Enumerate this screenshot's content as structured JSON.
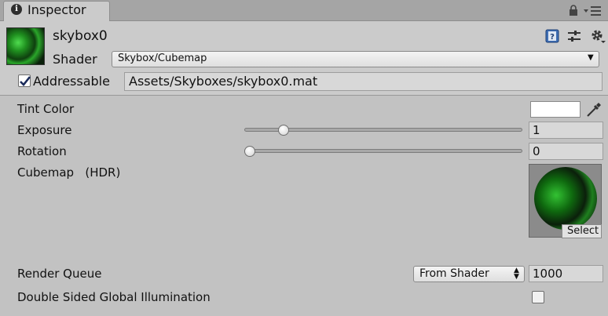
{
  "window": {
    "tab_title": "Inspector",
    "tab_icon": "info-icon",
    "tab_icons": [
      "lock-icon",
      "menu-icon"
    ]
  },
  "header": {
    "material_name": "skybox0",
    "shader_label": "Shader",
    "shader_value": "Skybox/Cubemap",
    "icons": [
      "help-icon",
      "preset-icon",
      "gear-icon"
    ],
    "addressable": {
      "label": "Addressable",
      "checked": true,
      "path": "Assets/Skyboxes/skybox0.mat"
    }
  },
  "properties": {
    "tint": {
      "label": "Tint Color",
      "value": "#ffffff"
    },
    "exposure": {
      "label": "Exposure",
      "value": "1",
      "slider_fraction": 0.125
    },
    "rotation": {
      "label": "Rotation",
      "value": "0",
      "slider_fraction": 0
    },
    "cubemap": {
      "label": "Cubemap   (HDR)",
      "select_label": "Select"
    },
    "render_queue": {
      "label": "Render Queue",
      "mode": "From Shader",
      "value": "1000"
    },
    "dsgi": {
      "label": "Double Sided Global Illumination",
      "checked": false
    }
  }
}
